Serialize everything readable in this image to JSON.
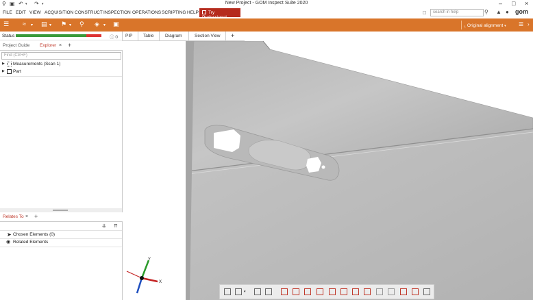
{
  "window": {
    "title": "New Project - GOM Inspect Suite 2020",
    "controls": [
      "minimize-icon",
      "maximize-icon",
      "close-icon"
    ]
  },
  "menubar": {
    "items": [
      "FILE",
      "EDIT",
      "VIEW",
      "ACQUISITION",
      "CONSTRUCT",
      "INSPECTION",
      "OPERATIONS",
      "SCRIPTING",
      "HELP"
    ],
    "try_professional": "Try Professional",
    "search_placeholder": "search in help",
    "brand": "gom"
  },
  "toolbar": {
    "color": "#d9752a",
    "alignment_label": "Original alignment"
  },
  "left_panel": {
    "status_label": "Status",
    "status_progress": 0.82,
    "info_count": "0",
    "tabs": [
      {
        "label": "Project Guide",
        "active": false
      },
      {
        "label": "Explorer",
        "active": true
      }
    ],
    "add_tab": "+",
    "find_placeholder": "Find (Ctrl+F)",
    "tree": [
      {
        "label": "Measurements (Scan 1)"
      },
      {
        "label": "Part"
      }
    ],
    "relates_tab": "Relates To",
    "relates_items": [
      "Chosen Elements (0)",
      "Related Elements"
    ]
  },
  "center_tabs": [
    "PIP",
    "Table",
    "Diagram",
    "Section View",
    "+"
  ],
  "axis": {
    "x": "X",
    "y": "Y"
  },
  "accent_red": "#b52b1d"
}
